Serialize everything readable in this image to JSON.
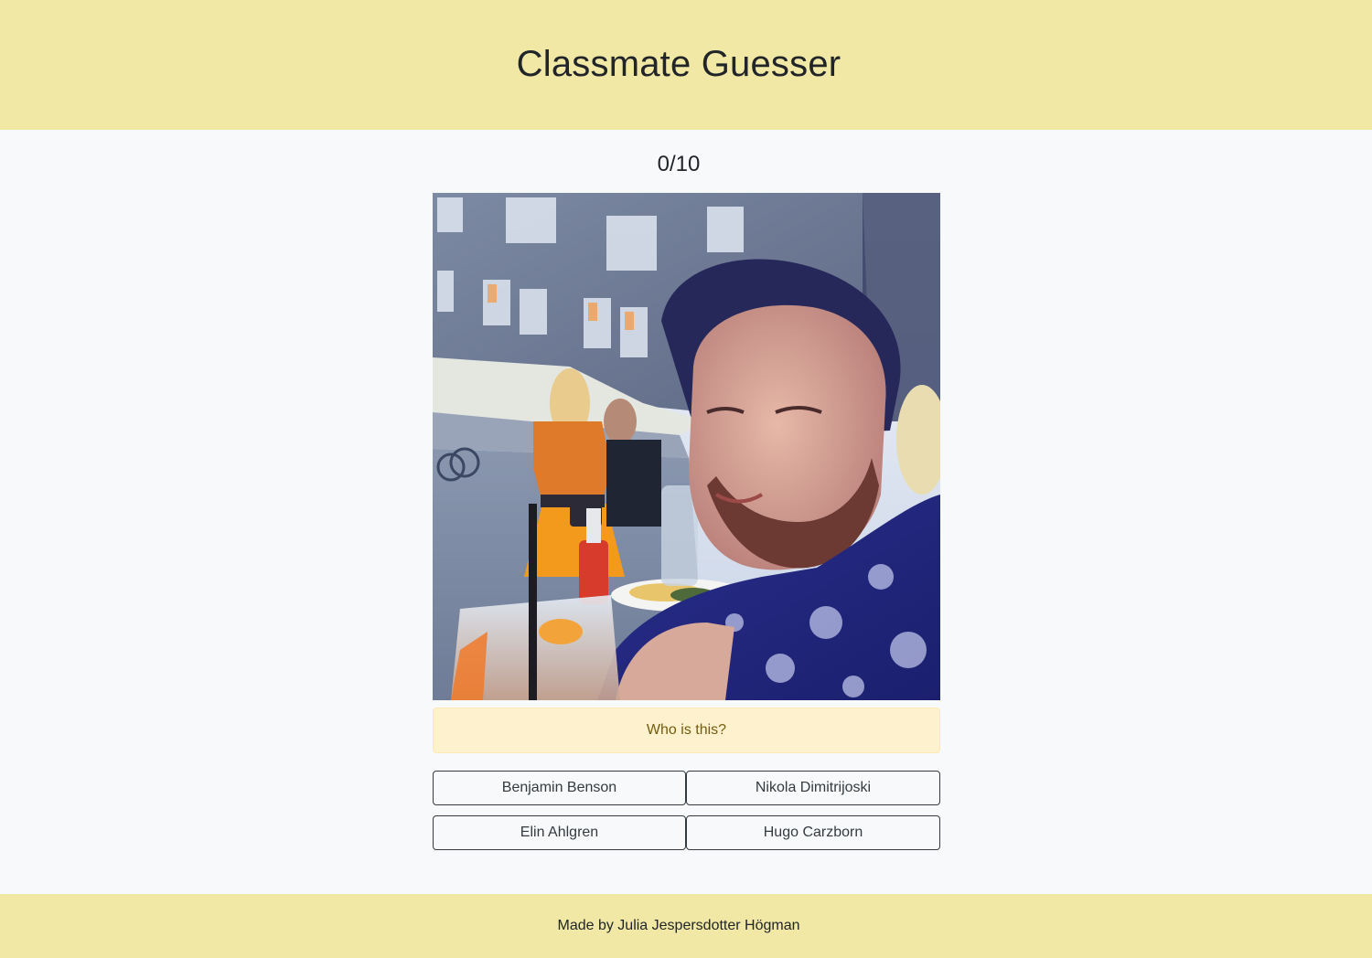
{
  "header": {
    "title": "Classmate Guesser"
  },
  "game": {
    "score": "0/10",
    "prompt": "Who is this?",
    "options": [
      {
        "label": "Benjamin Benson"
      },
      {
        "label": "Nikola Dimitrijoski"
      },
      {
        "label": "Elin Ahlgren"
      },
      {
        "label": "Hugo Carzborn"
      }
    ]
  },
  "footer": {
    "credit": "Made by Julia Jespersdotter Högman"
  },
  "colors": {
    "header_bg": "#f0e8a4",
    "page_bg": "#f8f9fa",
    "prompt_bg": "#fdf2cd",
    "prompt_text": "#735b11",
    "button_border": "#343a40"
  }
}
